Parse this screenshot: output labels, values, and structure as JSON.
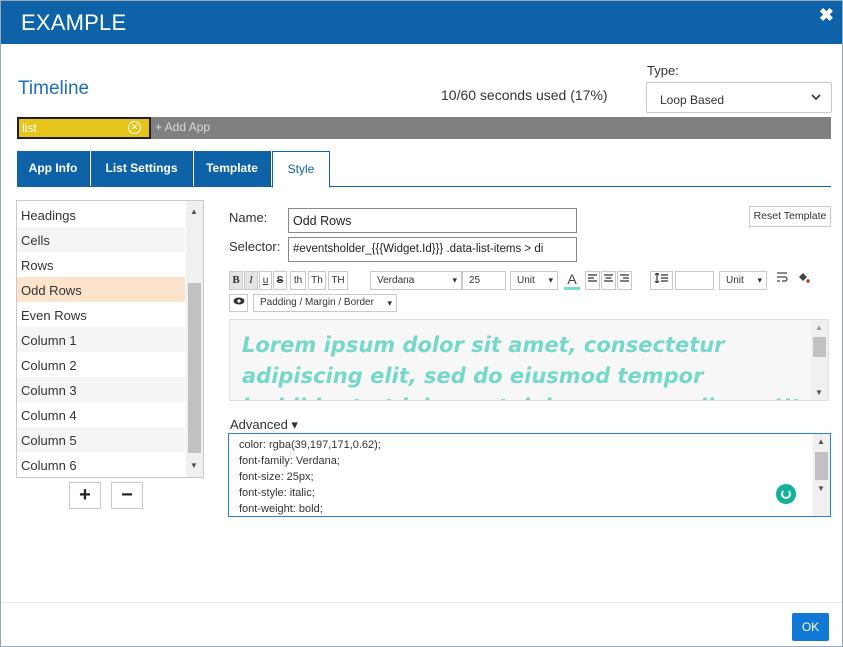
{
  "window": {
    "title": "EXAMPLE",
    "close_glyph": "✖"
  },
  "timeline": {
    "title": "Timeline",
    "usage": "10/60 seconds used (17%)",
    "type_label": "Type:",
    "type_value": "Loop Based"
  },
  "apps": {
    "items": [
      {
        "label": "list"
      }
    ],
    "add_label": "+ Add App",
    "chip_color": "#e6c41a"
  },
  "tabs": [
    {
      "label": "App Info"
    },
    {
      "label": "List Settings"
    },
    {
      "label": "Template"
    },
    {
      "label": "Style",
      "active": true
    }
  ],
  "style_list": {
    "items": [
      "Headings",
      "Cells",
      "Rows",
      "Odd Rows",
      "Even Rows",
      "Column 1",
      "Column 2",
      "Column 3",
      "Column 4",
      "Column 5",
      "Column 6"
    ],
    "selected": "Odd Rows",
    "add_label": "+",
    "remove_label": "−"
  },
  "editor": {
    "name_label": "Name:",
    "name_value": "Odd Rows",
    "selector_label": "Selector:",
    "selector_value": "#eventsholder_{{{Widget.Id}}} .data-list-items > di",
    "reset_label": "Reset Template",
    "toolbar": {
      "bold": "B",
      "italic": "I",
      "underline": "u",
      "strike": "S",
      "th1": "th",
      "th2": "Th",
      "th3": "TH",
      "font": "Verdana",
      "size": "25",
      "unit1": "Unit",
      "unit2": "Unit",
      "font_color_glyph": "A",
      "padding_label": "Padding / Margin / Border"
    },
    "preview_text": "Lorem ipsum dolor sit amet, consectetur adipiscing elit, sed do eiusmod tempor incididunt ut labore et dolore magna aliqua. Ut enim ad minim veniam",
    "advanced_label": "Advanced ▾",
    "css_lines": [
      "color: rgba(39,197,171,0.62);",
      "font-family: Verdana;",
      "font-size: 25px;",
      "font-style: italic;",
      "font-weight: bold;"
    ]
  },
  "footer": {
    "ok_label": "OK"
  },
  "colors": {
    "primary": "#0e62a8",
    "accent_text": "#27c5ab",
    "selected_row": "#fce3cc",
    "ok": "#1278d5"
  }
}
